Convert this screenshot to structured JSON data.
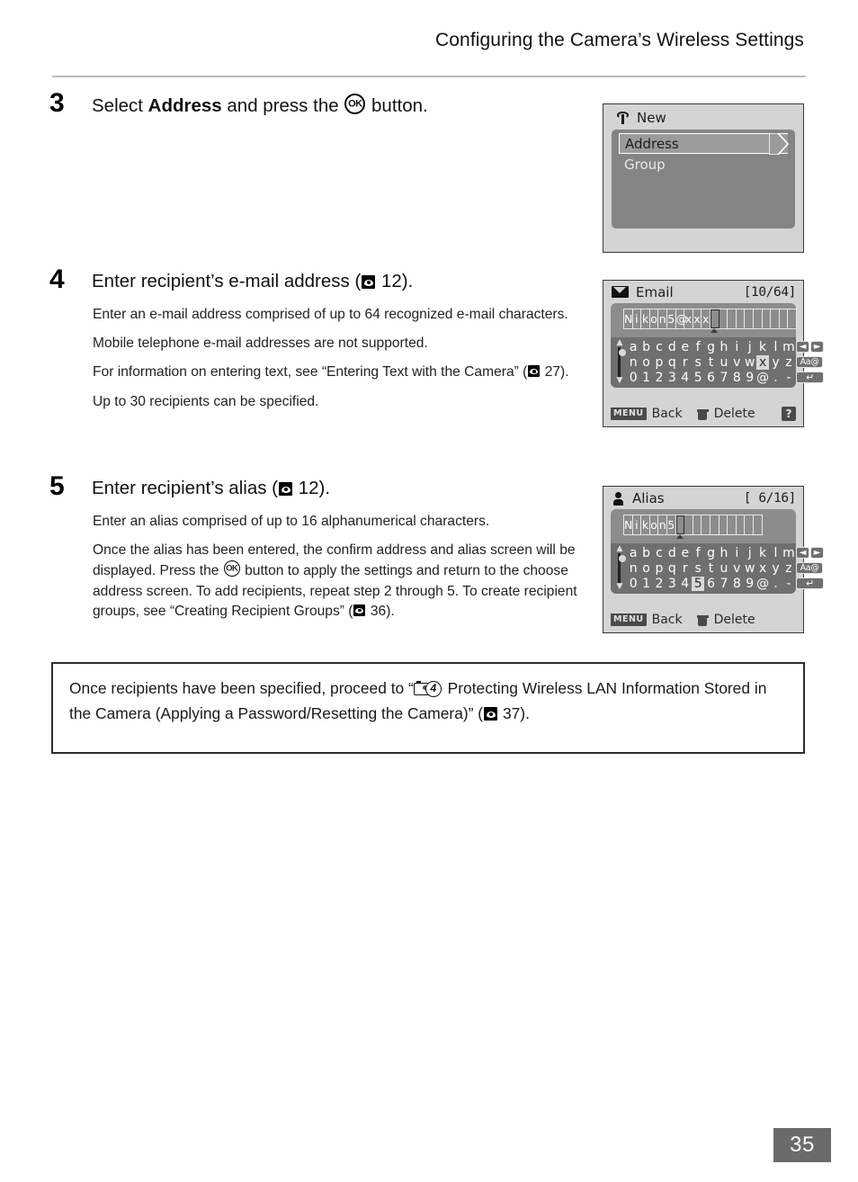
{
  "header": {
    "running_head": "Configuring the Camera’s Wireless Settings"
  },
  "steps": [
    {
      "number": "3",
      "title_before": "Select ",
      "title_bold": "Address",
      "title_after_1": " and press the ",
      "title_after_2": " button."
    },
    {
      "number": "4",
      "title_before": "Enter recipient’s e-mail address (",
      "title_ref": "12",
      "title_after": ").",
      "paragraphs": [
        "Enter an e-mail address comprised of up to 64 recognized e-mail characters.",
        "Mobile telephone e-mail addresses are not supported.",
        "Up to 30 recipients can be specified."
      ],
      "para_text_ref_a": "For information on entering text, see “Entering Text with the Camera” (",
      "para_text_ref_num": "27",
      "para_text_ref_b": ")."
    },
    {
      "number": "5",
      "title_before": "Enter recipient’s alias (",
      "title_ref": "12",
      "title_after": ").",
      "paragraphs": [
        "Enter an alias comprised of up to 16 alphanumerical characters."
      ],
      "para_ok_a": "Once the alias has been entered, the confirm address and alias screen will be displayed. Press the ",
      "para_ok_b": " button to apply the settings and return to the choose address screen. To add recipients, repeat step 2 through 5. To create recipient groups, see “Creating Recipient Groups” (",
      "para_ok_ref": "36",
      "para_ok_c": ")."
    }
  ],
  "note": {
    "text_a": "Once recipients have been specified, proceed to “",
    "cam_number": "4",
    "text_b": " Protecting Wireless LAN Information Stored in the Camera (Applying a Password/Resetting the Camera)” (",
    "ref_page": "37",
    "text_c": ")."
  },
  "screens": {
    "new": {
      "title": "New",
      "items": [
        {
          "label": "Address",
          "selected": true
        },
        {
          "label": "Group",
          "selected": false
        }
      ]
    },
    "email": {
      "title": "Email",
      "counter": "[10/64]",
      "value": "Nikon5@xxx",
      "total_cells": 20,
      "cursor_index": 10,
      "highlight_key": "x",
      "highlight_row": 2,
      "keys_row1": [
        "a",
        "b",
        "c",
        "d",
        "e",
        "f",
        "g",
        "h",
        "i",
        "j",
        "k",
        "l",
        "m"
      ],
      "keys_row2": [
        "n",
        "o",
        "p",
        "q",
        "r",
        "s",
        "t",
        "u",
        "v",
        "w",
        "x",
        "y",
        "z"
      ],
      "keys_row3": [
        "0",
        "1",
        "2",
        "3",
        "4",
        "5",
        "6",
        "7",
        "8",
        "9",
        "@",
        ".",
        "-"
      ],
      "btn_left": "◄",
      "btn_right": "►",
      "btn_case": "Aa@",
      "btn_enter": "↵",
      "footer": {
        "menu_badge": "MENU",
        "back_label": "Back",
        "delete_label": "Delete",
        "help_label": "?",
        "show_help": true
      }
    },
    "alias": {
      "title": "Alias",
      "counter": "[ 6/16]",
      "value": "Nikon5",
      "total_cells": 16,
      "cursor_index": 6,
      "highlight_key": "5",
      "highlight_row": 3,
      "keys_row1": [
        "a",
        "b",
        "c",
        "d",
        "e",
        "f",
        "g",
        "h",
        "i",
        "j",
        "k",
        "l",
        "m"
      ],
      "keys_row2": [
        "n",
        "o",
        "p",
        "q",
        "r",
        "s",
        "t",
        "u",
        "v",
        "w",
        "x",
        "y",
        "z"
      ],
      "keys_row3": [
        "0",
        "1",
        "2",
        "3",
        "4",
        "5",
        "6",
        "7",
        "8",
        "9",
        "@",
        ".",
        "-"
      ],
      "btn_left": "◄",
      "btn_right": "►",
      "btn_case": "Aa@",
      "btn_enter": "↵",
      "footer": {
        "menu_badge": "MENU",
        "back_label": "Back",
        "delete_label": "Delete",
        "help_label": "",
        "show_help": false
      }
    }
  },
  "footer": {
    "page_number": "35"
  },
  "colors": {
    "lcd_background": "#d3d4d4",
    "lcd_panel": "#848484",
    "lcd_keys": "#6f6f6f",
    "page_number_bg": "#6b6b6b",
    "rule": "#bcbcbc"
  }
}
